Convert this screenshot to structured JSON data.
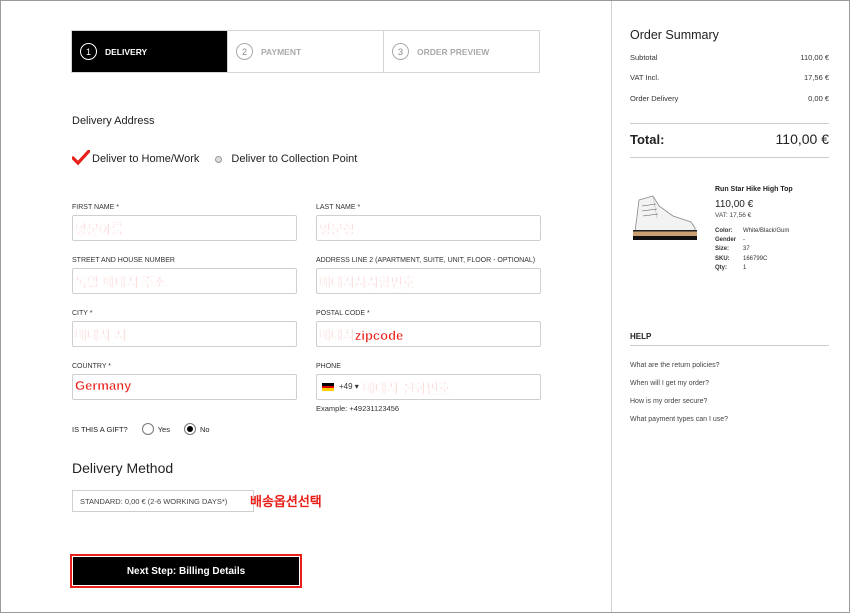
{
  "steps": [
    {
      "num": "1",
      "label": "DELIVERY",
      "active": true
    },
    {
      "num": "2",
      "label": "PAYMENT",
      "active": false
    },
    {
      "num": "3",
      "label": "ORDER PREVIEW",
      "active": false
    }
  ],
  "delivery_address_title": "Delivery Address",
  "delivery_options": {
    "home": "Deliver to Home/Work",
    "collection": "Deliver to Collection Point"
  },
  "form": {
    "first_name": {
      "label": "FIRST NAME *",
      "value": "영문이름"
    },
    "last_name": {
      "label": "LAST NAME *",
      "value": "영문성"
    },
    "street": {
      "label": "STREET AND HOUSE NUMBER",
      "value": "독일 배대지 주소"
    },
    "address2": {
      "label": "ADDRESS LINE 2 (APARTMENT, SUITE, UNIT, FLOOR - OPTIONAL)",
      "value": "배대지사서함번호"
    },
    "city": {
      "label": "CITY *",
      "value": "배대지 시"
    },
    "postal": {
      "label": "POSTAL CODE *",
      "value": "배대지zipcode"
    },
    "country": {
      "label": "COUNTRY *",
      "value": "Germany"
    },
    "phone": {
      "label": "PHONE",
      "code": "+49 ▾",
      "value": "배대지 전화번호",
      "example": "Example: +49231123456"
    }
  },
  "gift": {
    "question": "IS THIS A GIFT?",
    "yes": "Yes",
    "no": "No",
    "selected": "No"
  },
  "delivery_method": {
    "title": "Delivery Method",
    "selected": "STANDARD: 0,00 € (2-6 WORKING DAYS*)",
    "annotation": "배송옵션선택"
  },
  "next_button": "Next Step: Billing Details",
  "summary": {
    "title": "Order Summary",
    "rows": [
      {
        "label": "Subtotal",
        "value": "110,00 €"
      },
      {
        "label": "VAT Incl.",
        "value": "17,56 €"
      },
      {
        "label": "Order Delivery",
        "value": "0,00 €"
      }
    ],
    "total_label": "Total:",
    "total_value": "110,00 €"
  },
  "product": {
    "name": "Run Star Hike High Top",
    "price": "110,00 €",
    "vat": "VAT: 17,56 €",
    "attributes": [
      {
        "k": "Color:",
        "v": "White/Black/Gum"
      },
      {
        "k": "Gender",
        "v": "-"
      },
      {
        "k": "Size:",
        "v": "37"
      },
      {
        "k": "SKU:",
        "v": "166799C"
      },
      {
        "k": "Qty:",
        "v": "1"
      }
    ]
  },
  "help": {
    "title": "HELP",
    "links": [
      "What are the return policies?",
      "When will I get my order?",
      "How is my order secure?",
      "What payment types can I use?"
    ]
  },
  "colors": {
    "accent_red": "#e8201a",
    "black": "#000000"
  }
}
